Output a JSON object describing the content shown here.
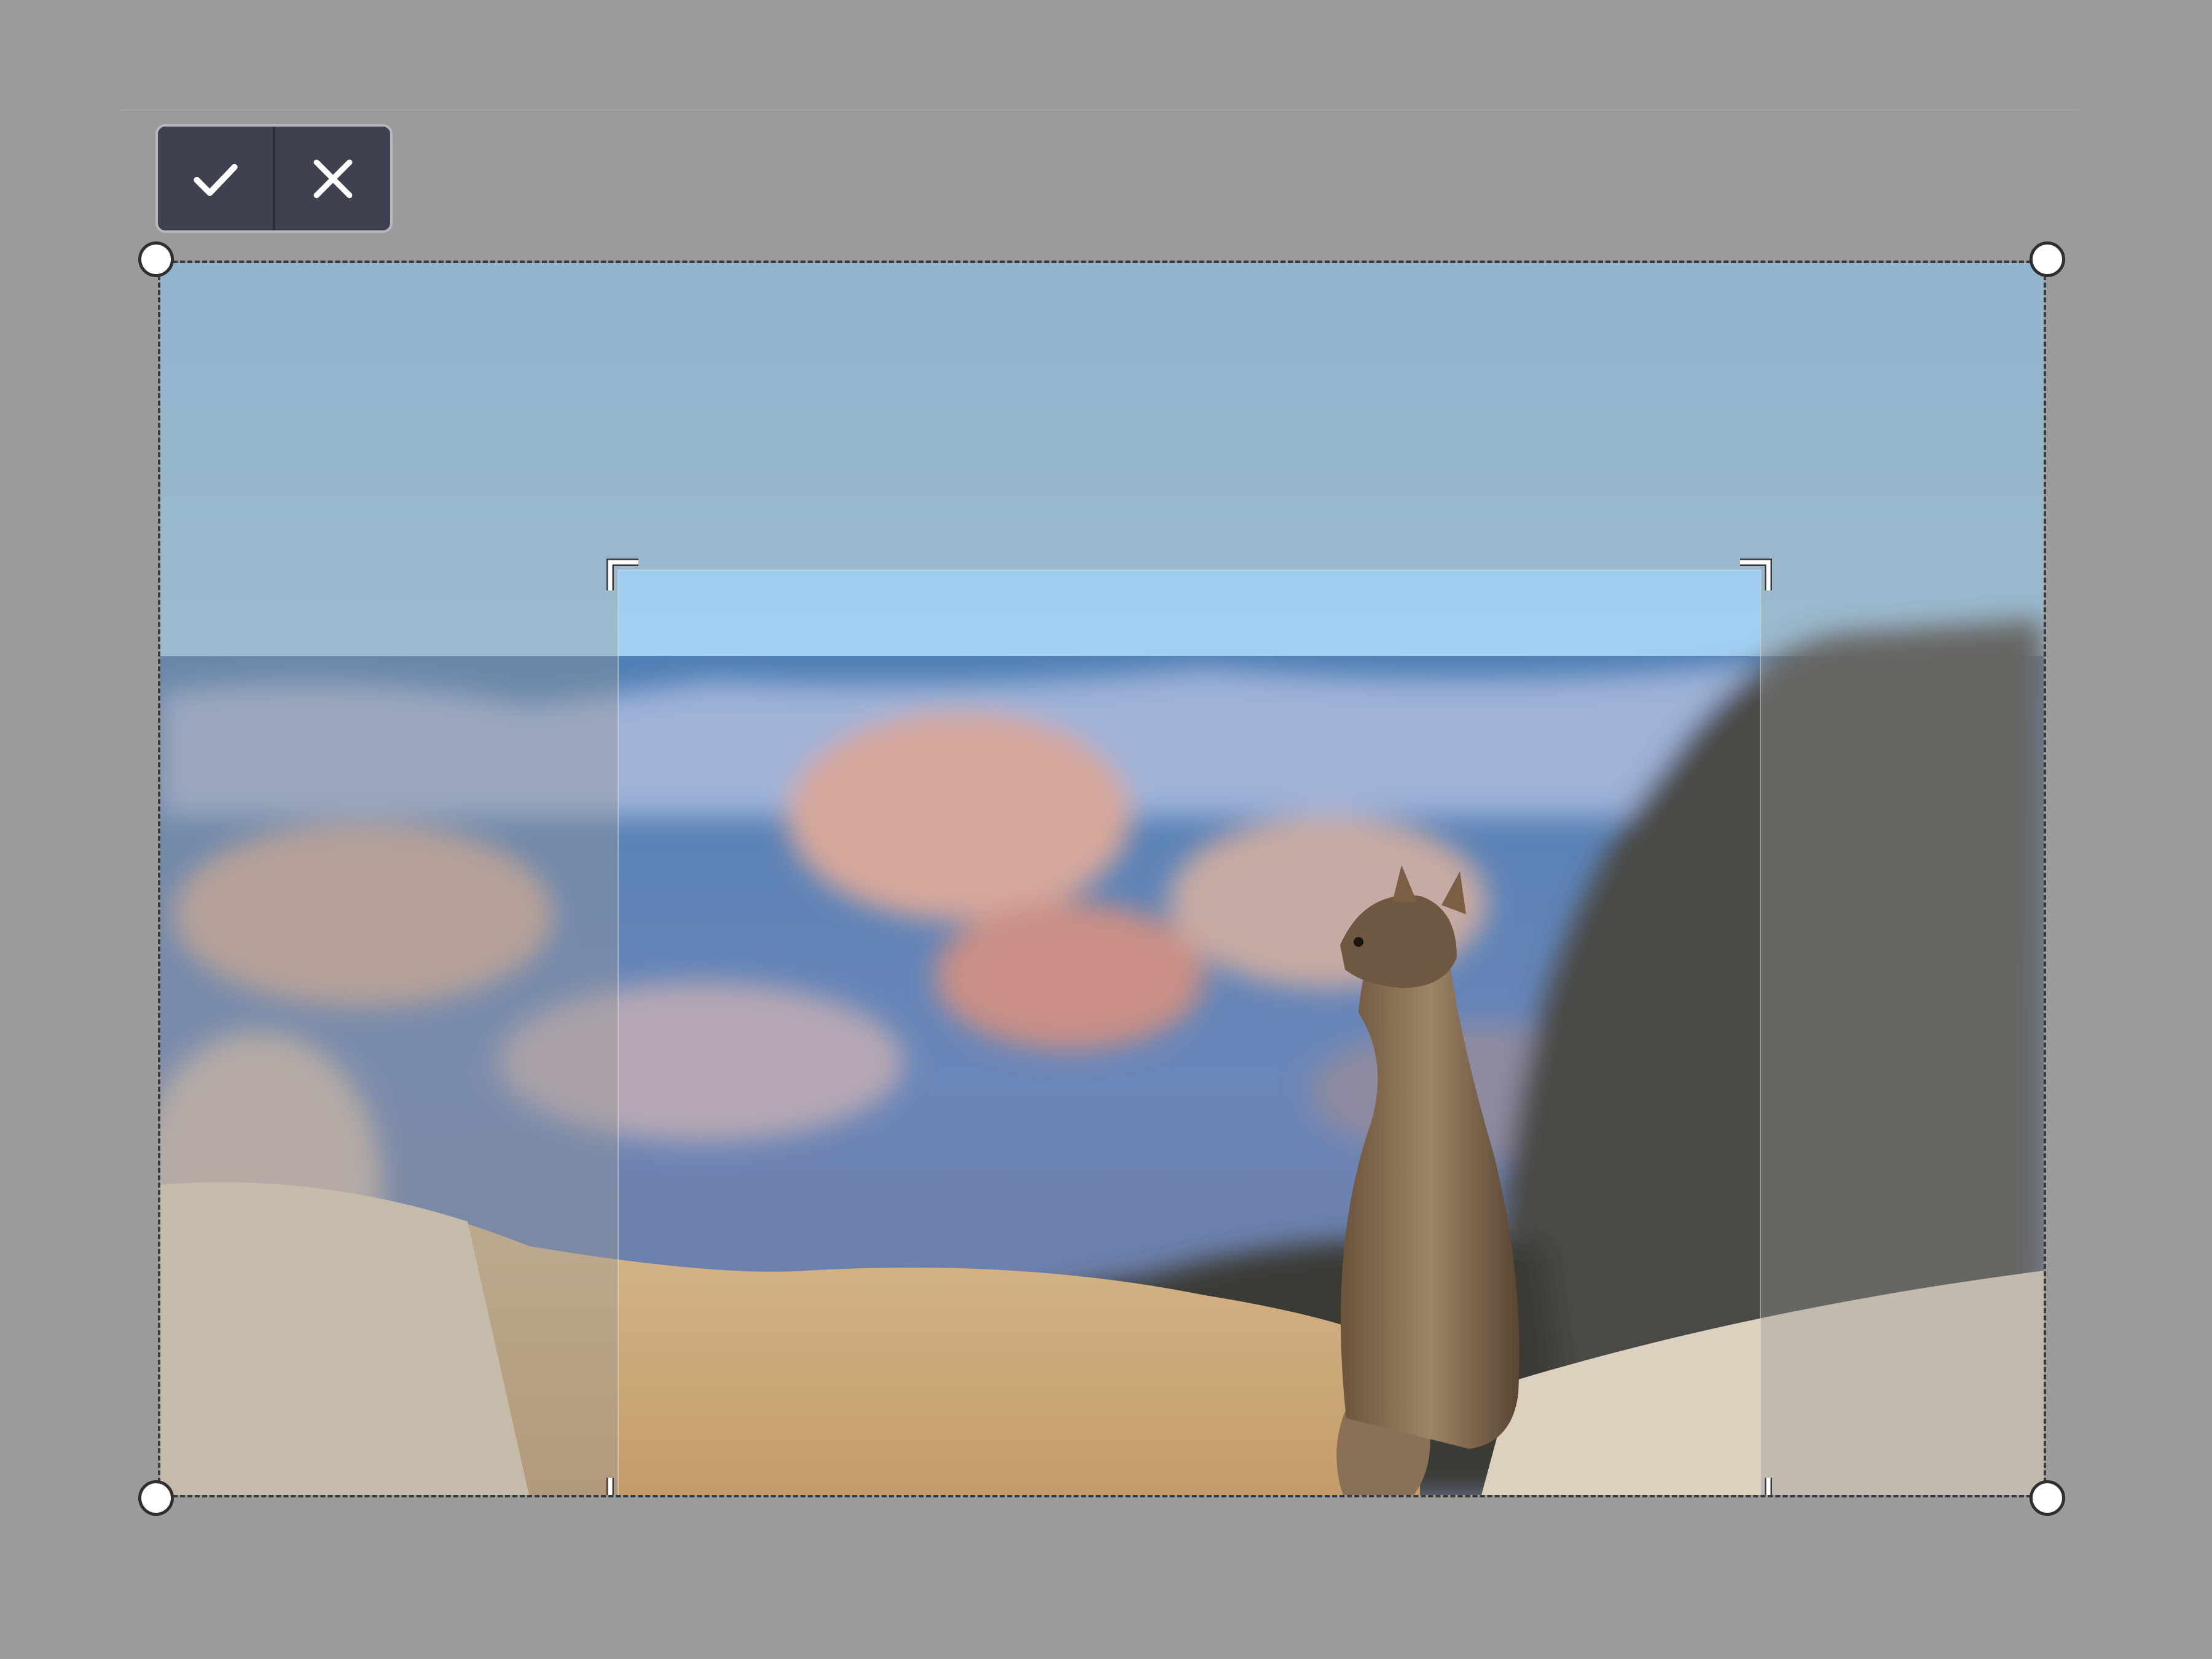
{
  "editor": {
    "mode": "crop",
    "toolbar": {
      "confirm": {
        "label": "",
        "icon": "checkmark-icon"
      },
      "cancel": {
        "label": "",
        "icon": "close-icon"
      }
    },
    "image": {
      "subject": "",
      "icon": "photo-image"
    },
    "handles": [
      "top-left",
      "top-right",
      "bottom-left",
      "bottom-right"
    ],
    "colors": {
      "workspace": "#9b9b9b",
      "toolbar": "#3f4150",
      "toolbar_border": "#b7b7bc",
      "handle_fill": "#ffffff",
      "handle_stroke": "#2f2f2f",
      "crop_corner": "#ffffff"
    }
  }
}
